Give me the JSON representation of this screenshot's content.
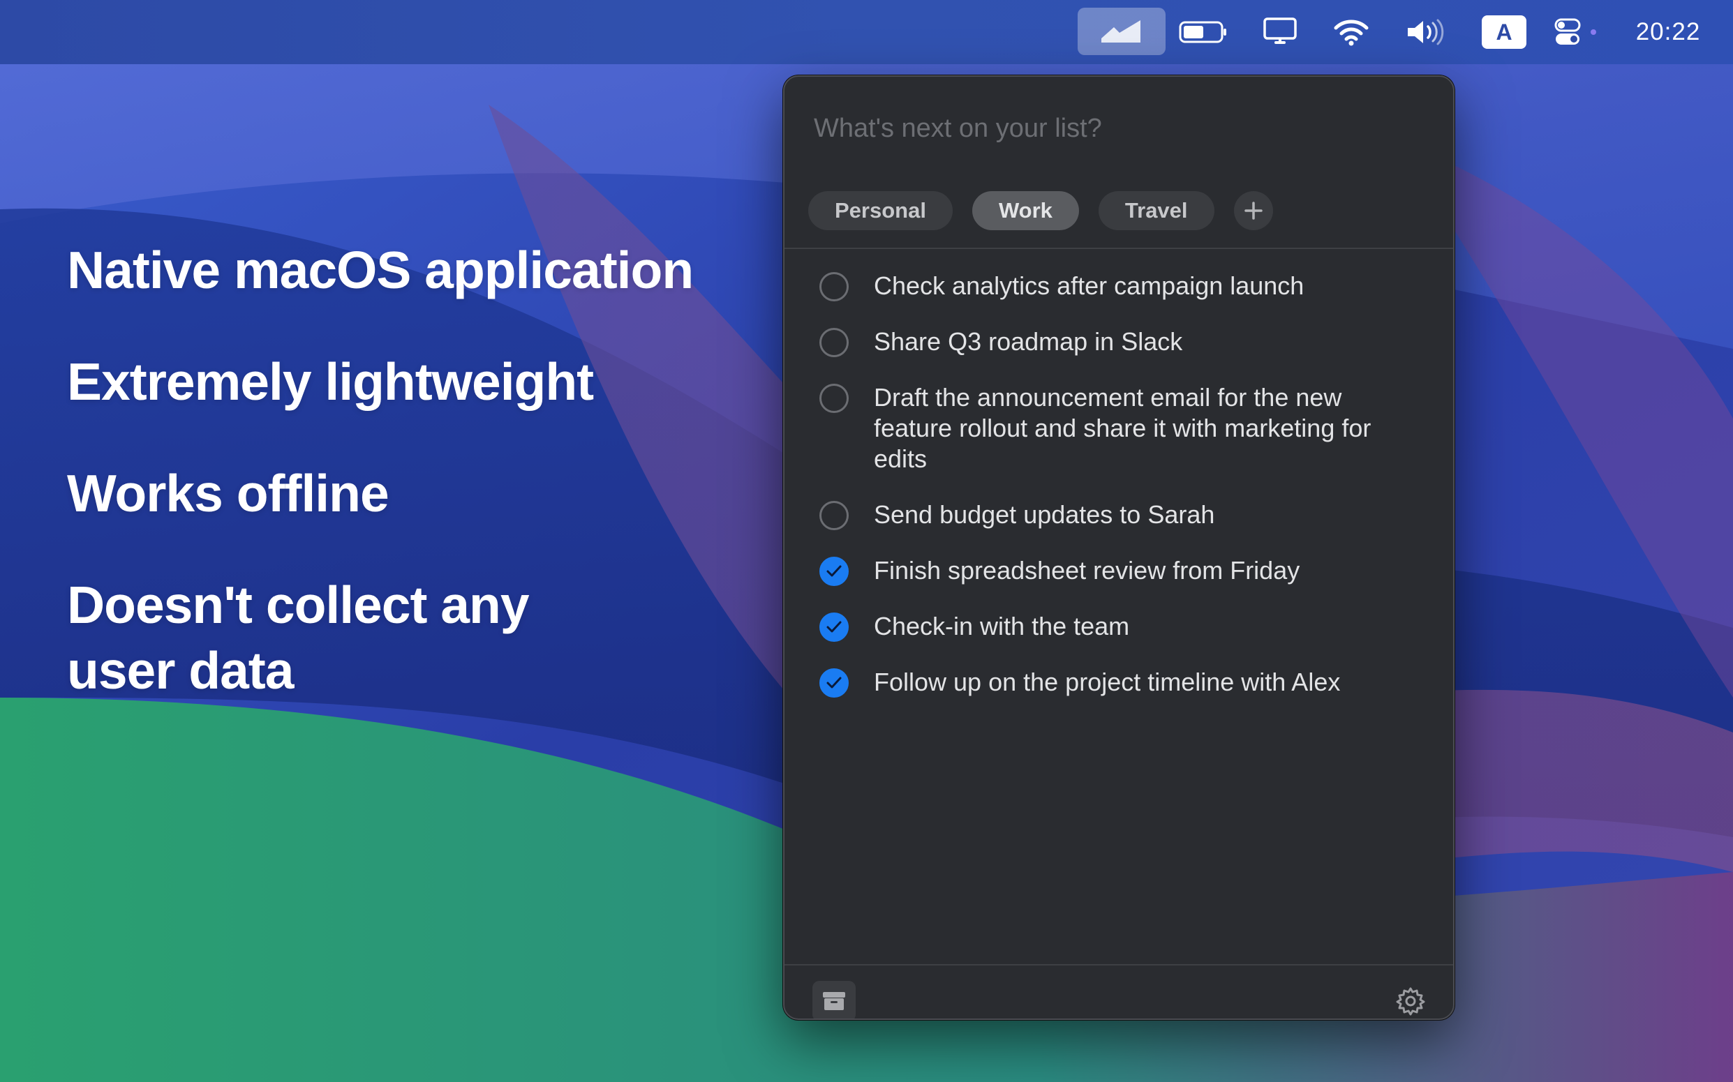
{
  "menubar": {
    "clock": "20:22",
    "input_source": "A",
    "icons": [
      "checkmark-app-icon",
      "battery-icon",
      "display-icon",
      "wifi-icon",
      "volume-icon",
      "input-source-icon",
      "control-center-icon"
    ]
  },
  "features": [
    "Native macOS application",
    "Extremely lightweight",
    "Works offline",
    "Doesn't collect any user data"
  ],
  "panel": {
    "input_placeholder": "What's next on your list?",
    "tabs": [
      {
        "label": "Personal",
        "active": false
      },
      {
        "label": "Work",
        "active": true
      },
      {
        "label": "Travel",
        "active": false
      }
    ],
    "todos": [
      {
        "text": "Check analytics after campaign launch",
        "done": false
      },
      {
        "text": "Share Q3 roadmap in Slack",
        "done": false
      },
      {
        "text": "Draft the announcement email for the new feature rollout and share it with marketing for edits",
        "done": false
      },
      {
        "text": "Send budget updates to Sarah",
        "done": false
      },
      {
        "text": "Finish spreadsheet review from Friday",
        "done": true
      },
      {
        "text": "Check-in with the team",
        "done": true
      },
      {
        "text": "Follow up on the project timeline with Alex",
        "done": true
      }
    ]
  },
  "colors": {
    "accent": "#1a7cf2",
    "panel_bg": "#2a2c30",
    "menubar_bg": "#3152b0"
  }
}
